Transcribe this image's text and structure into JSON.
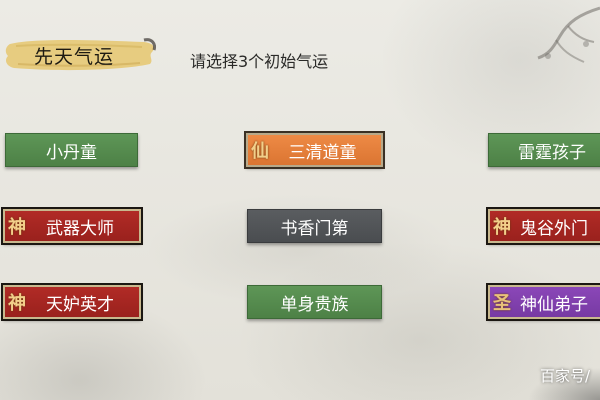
{
  "header": {
    "title": "先天气运",
    "prompt": "请选择3个初始气运"
  },
  "options": [
    {
      "label": "小丹童",
      "style": "green",
      "seal": ""
    },
    {
      "label": "三清道童",
      "style": "orange",
      "seal": "仙"
    },
    {
      "label": "雷霆孩子",
      "style": "green",
      "seal": ""
    },
    {
      "label": "武器大师",
      "style": "red",
      "seal": "神"
    },
    {
      "label": "书香门第",
      "style": "gray",
      "seal": ""
    },
    {
      "label": "鬼谷外门",
      "style": "red",
      "seal": "神"
    },
    {
      "label": "天妒英才",
      "style": "red",
      "seal": "神"
    },
    {
      "label": "单身贵族",
      "style": "green",
      "seal": ""
    },
    {
      "label": "神仙弟子",
      "style": "purple",
      "seal": "圣"
    }
  ],
  "watermark": "百家号/",
  "colors": {
    "green": "#5e9657",
    "gray": "#55585b",
    "orange": "#e9823f",
    "red": "#a8261f",
    "purple": "#8442b0",
    "gold_banner": "#e9d08a"
  }
}
